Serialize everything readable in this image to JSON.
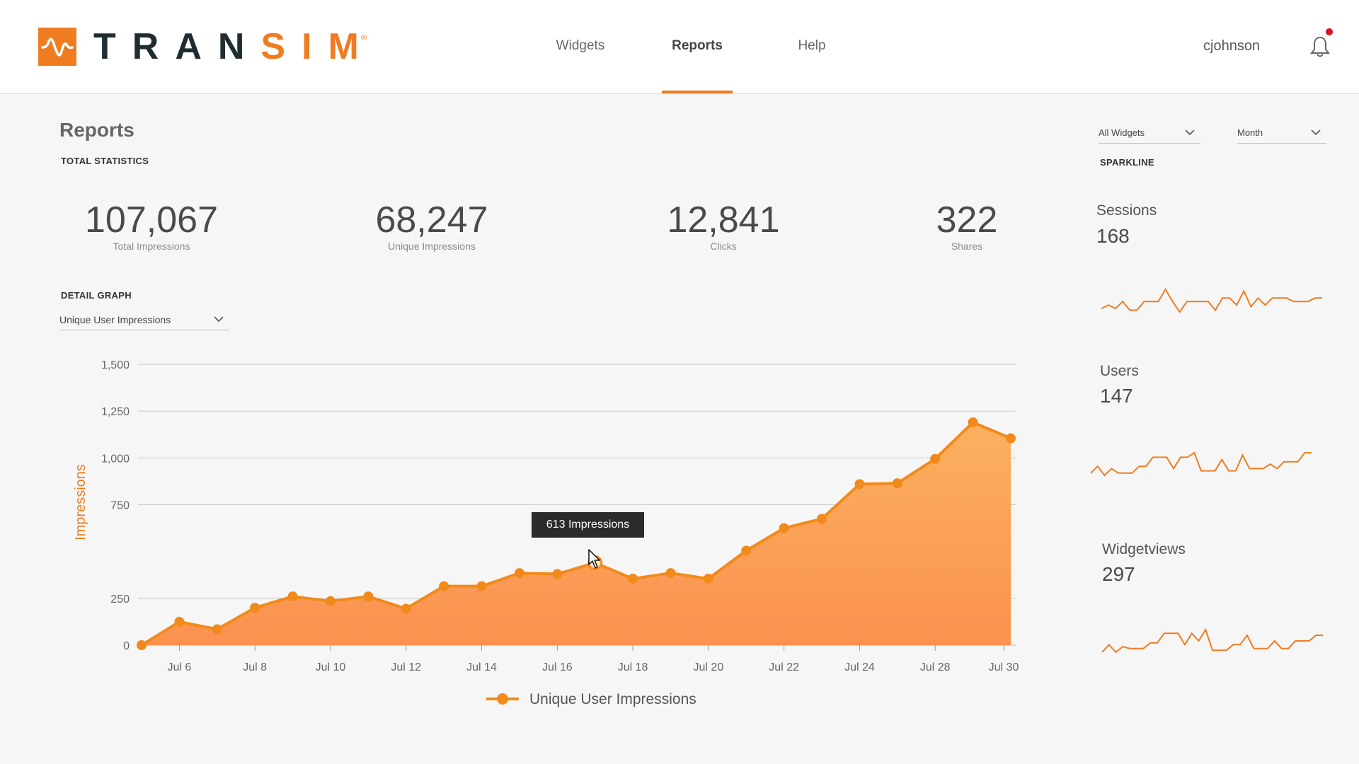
{
  "header": {
    "logo": {
      "text_main": "TRAN",
      "text_accent": "SIM",
      "reg": "®"
    },
    "nav": [
      {
        "label": "Widgets",
        "active": false
      },
      {
        "label": "Reports",
        "active": true
      },
      {
        "label": "Help",
        "active": false
      }
    ],
    "username": "cjohnson",
    "notification_icon": "bell-icon",
    "accent_color": "#f07c22"
  },
  "page": {
    "title": "Reports",
    "total_statistics_label": "TOTAL STATISTICS",
    "detail_graph_label": "DETAIL GRAPH",
    "sparkline_label": "SPARKLINE"
  },
  "stats": [
    {
      "value": "107,067",
      "label": "Total Impressions"
    },
    {
      "value": "68,247",
      "label": "Unique Impressions"
    },
    {
      "value": "12,841",
      "label": "Clicks"
    },
    {
      "value": "322",
      "label": "Shares"
    }
  ],
  "filters": {
    "widgets": {
      "selected": "All Widgets"
    },
    "period": {
      "selected": "Month"
    },
    "metric": {
      "selected": "Unique User Impressions"
    }
  },
  "tooltip": {
    "text": "613 Impressions"
  },
  "chart_data": {
    "type": "area",
    "ylabel": "Impressions",
    "ylim": [
      0,
      1500
    ],
    "yticks": [
      0,
      250,
      750,
      1000,
      1250,
      1500
    ],
    "ytick_labels": [
      "0",
      "250",
      "750",
      "1,000",
      "1,250",
      "1,500"
    ],
    "xtick_labels": [
      "Jul 6",
      "Jul 8",
      "Jul 10",
      "Jul 12",
      "Jul 14",
      "Jul 16",
      "Jul 18",
      "Jul 20",
      "Jul 22",
      "Jul 24",
      "Jul 28",
      "Jul 30"
    ],
    "grid": true,
    "legend_position": "bottom",
    "series": [
      {
        "name": "Unique User Impressions",
        "color": "#f28a1a",
        "values": [
          0,
          125,
          85,
          200,
          260,
          235,
          260,
          195,
          315,
          315,
          385,
          380,
          440,
          355,
          385,
          355,
          505,
          625,
          675,
          860,
          865,
          995,
          1190,
          1105
        ]
      }
    ]
  },
  "sparklines": [
    {
      "title": "Sessions",
      "value": "168",
      "values": [
        3,
        5,
        3,
        7,
        2,
        2,
        7,
        7,
        7,
        14,
        7,
        1,
        7,
        7,
        7,
        7,
        2,
        9,
        9,
        5,
        13,
        4,
        9,
        5,
        9,
        9,
        9,
        7,
        7,
        7,
        9,
        9
      ]
    },
    {
      "title": "Users",
      "value": "147",
      "values": [
        3,
        6,
        2,
        5,
        3,
        3,
        3,
        6,
        6,
        10,
        10,
        10,
        5,
        10,
        10,
        12,
        4,
        4,
        4,
        9,
        4,
        4,
        11,
        5,
        5,
        5,
        7,
        5,
        8,
        8,
        8,
        12,
        12
      ]
    },
    {
      "title": "Widgetviews",
      "value": "297",
      "values": [
        2,
        6,
        2,
        5,
        4,
        4,
        4,
        7,
        7,
        12,
        12,
        12,
        6,
        12,
        8,
        14,
        3,
        3,
        3,
        6,
        6,
        11,
        4,
        4,
        4,
        8,
        4,
        4,
        8,
        8,
        8,
        11,
        11
      ]
    }
  ]
}
